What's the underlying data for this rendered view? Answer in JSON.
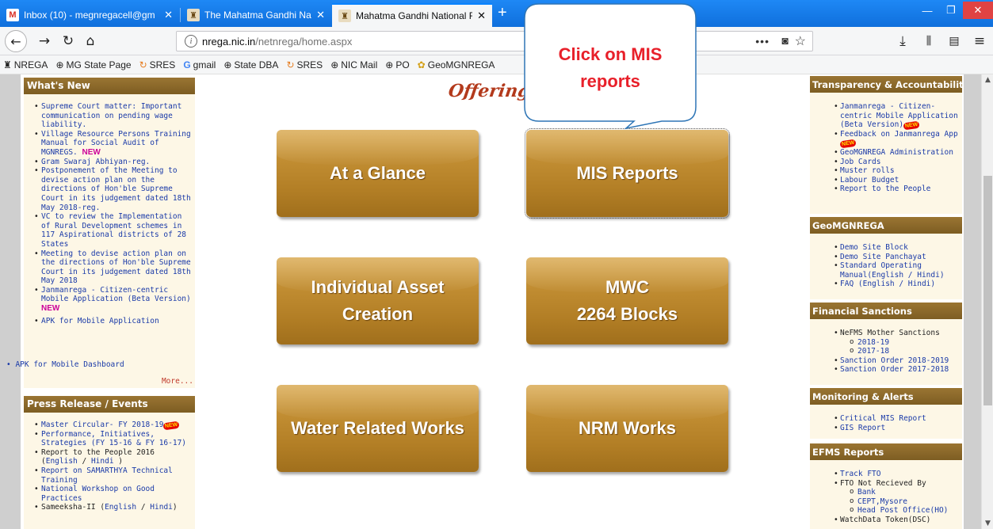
{
  "browser": {
    "tabs": [
      {
        "title": "Inbox (10) - megnregacell@gm",
        "icon": "gmail-icon",
        "active": false
      },
      {
        "title": "The Mahatma Gandhi National",
        "icon": "emblem-icon",
        "active": false
      },
      {
        "title": "Mahatma Gandhi National Rura",
        "icon": "emblem-icon",
        "active": true
      }
    ],
    "new_tab_label": "+",
    "url_host": "nrega.nic.in",
    "url_path": "/netnrega/home.aspx",
    "url_more": "•••",
    "bookmarks": [
      {
        "label": "NREGA",
        "icon": "emblem-icon"
      },
      {
        "label": "MG State Page",
        "icon": "globe-icon"
      },
      {
        "label": "SRES",
        "icon": "refresh-icon"
      },
      {
        "label": "gmail",
        "icon": "google-icon"
      },
      {
        "label": "State DBA",
        "icon": "globe-icon"
      },
      {
        "label": "SRES",
        "icon": "refresh-icon"
      },
      {
        "label": "NIC Mail",
        "icon": "globe-icon"
      },
      {
        "label": "PO",
        "icon": "globe-icon"
      },
      {
        "label": "GeoMGNREGA",
        "icon": "flower-icon"
      }
    ]
  },
  "page": {
    "left": {
      "whats_new": {
        "title": "What's New",
        "items": [
          {
            "text": "Supreme Court matter: Important communication on pending wage liability.",
            "new": false
          },
          {
            "text": "Village Resource Persons Training Manual for Social Audit of MGNREGS.",
            "new": true
          },
          {
            "text": "Gram Swaraj Abhiyan-reg.",
            "new": false
          },
          {
            "text": "Postponement of the Meeting to devise action plan on the directions of Hon'ble Supreme Court in its judgement dated 18th May 2018-reg.",
            "new": false
          },
          {
            "text": "VC to review the Implementation of Rural Development schemes in 117 Aspirational districts of 28 States",
            "new": false
          },
          {
            "text": "Meeting to devise action plan on the directions of Hon'ble Supreme Court in its judgement dated 18th May 2018",
            "new": false
          },
          {
            "text": "Janmanrega - Citizen-centric Mobile Application (Beta Version)",
            "new": true
          },
          {
            "text": "APK for Mobile Application",
            "new": false
          }
        ],
        "new_label": "NEW",
        "extra_item": "APK for Mobile Dashboard",
        "more_label": "More..."
      },
      "press": {
        "title": "Press Release / Events",
        "new_badge": "NEW",
        "items": {
          "i1": "Master Circular- FY 2018-19",
          "i2": "Performance, Initiatives, Strategies (FY 15-16 & FY 16-17)",
          "i3a": "Report to the People 2016 (",
          "i3b": "English",
          "i3c": " / ",
          "i3d": "Hindi",
          "i3e": " )",
          "i4": "Report on SAMARTHYA Technical Training",
          "i5": "National Workshop on Good Practices",
          "i6a": "Sameeksha-II (",
          "i6b": "English",
          "i6c": " / ",
          "i6d": "Hindi",
          "i6e": ")"
        }
      }
    },
    "center": {
      "offerings_title": "Offerings",
      "buttons": {
        "glance": "At a Glance",
        "mis": "MIS Reports",
        "asset": "Individual Asset\nCreation",
        "mwc": "MWC\n2264 Blocks",
        "water": "Water Related Works",
        "nrm": "NRM Works"
      },
      "callout": "Click on  MIS\nreports"
    },
    "right": {
      "transparency": {
        "title": "Transparency & Accountability",
        "items": [
          "Janmanrega - Citizen-centric Mobile Application (Beta Version)",
          "Feedback on Janmanrega App",
          "GeoMGNREGA Administration",
          "Job Cards",
          "Muster rolls",
          "Labour Budget",
          "Report to the People"
        ]
      },
      "geo": {
        "title": "GeoMGNREGA",
        "items": [
          "Demo Site Block",
          "Demo Site Panchayat",
          "Standard Operating Manual(English / Hindi)",
          "FAQ (English / Hindi)"
        ]
      },
      "financial": {
        "title": "Financial Sanctions",
        "mother": "NeFMS Mother Sanctions",
        "sub": [
          "2018-19",
          "2017-18"
        ],
        "orders": [
          "Sanction Order 2018-2019",
          "Sanction Order 2017-2018"
        ]
      },
      "monitoring": {
        "title": "Monitoring & Alerts",
        "items": [
          "Critical MIS Report",
          "GIS Report"
        ]
      },
      "efms": {
        "title": "EFMS Reports",
        "track": "Track FTO",
        "fto": "FTO Not Recieved By",
        "sub": [
          "Bank",
          "CEPT,Mysore",
          "Head Post Office(HO)"
        ],
        "token": "WatchData Token(DSC)"
      }
    }
  }
}
